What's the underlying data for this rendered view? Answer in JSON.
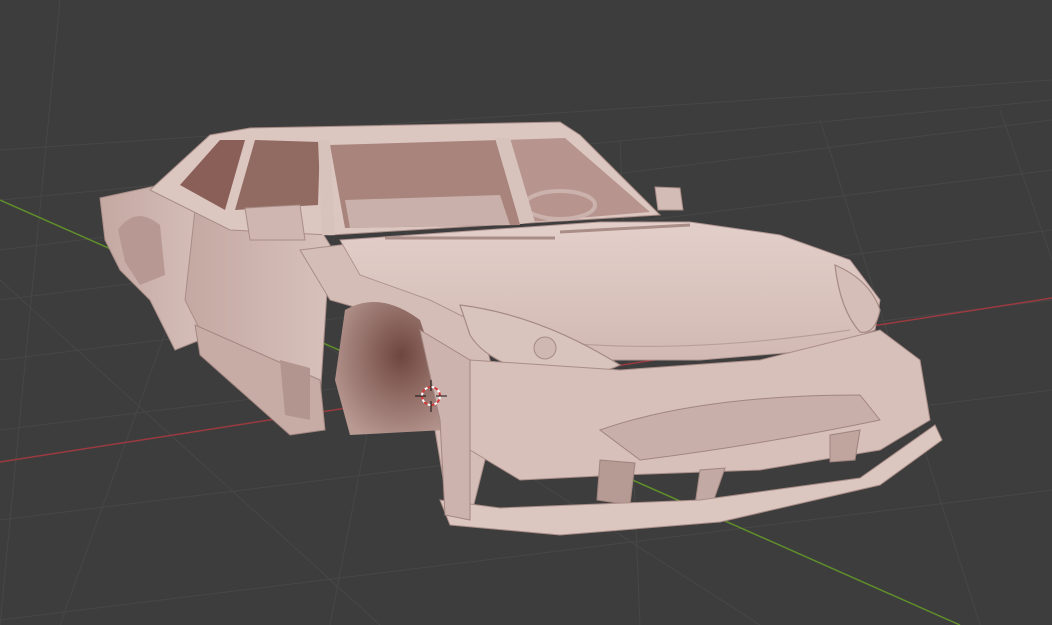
{
  "viewport": {
    "background_color": "#3d3d3d",
    "grid_color": "#4a4a4a",
    "x_axis_color": "#9b3a3f",
    "y_axis_color": "#5f8f2a",
    "cursor_icon": "3d-cursor-icon",
    "model": {
      "name": "car-body",
      "shading": "solid",
      "base_color": "#d6beb8",
      "shadow_color": "#a88a84",
      "interior_color": "#7a5048"
    }
  }
}
